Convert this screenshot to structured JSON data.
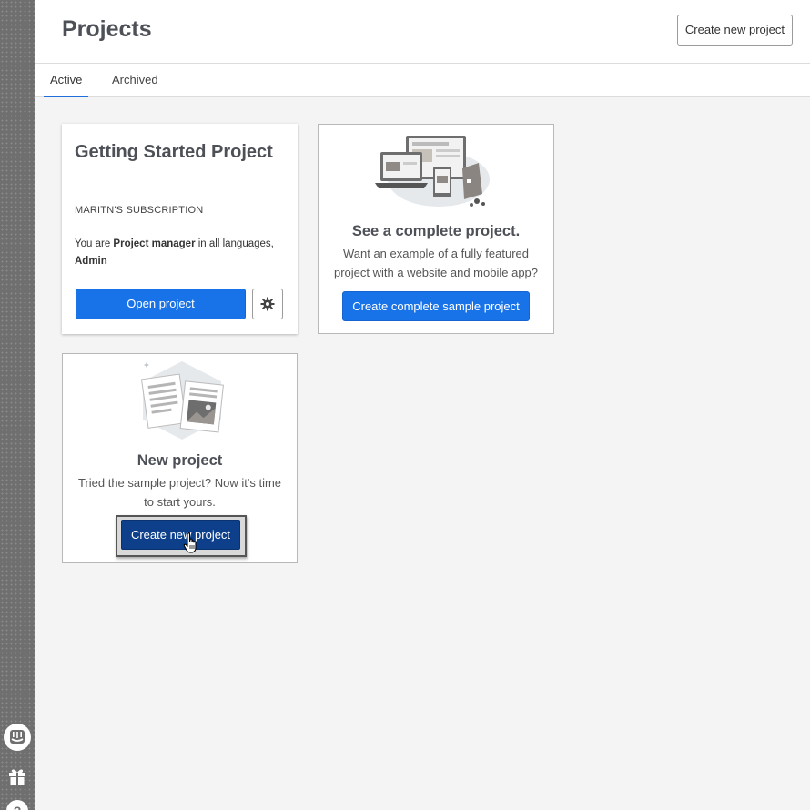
{
  "header": {
    "title": "Projects",
    "create_button": "Create new project"
  },
  "tabs": [
    {
      "label": "Active",
      "active": true
    },
    {
      "label": "Archived",
      "active": false
    }
  ],
  "project_card": {
    "title": "Getting Started Project",
    "subscription": "MARITN'S SUBSCRIPTION",
    "role_prefix": "You are ",
    "role": "Project manager",
    "role_mid": " in all languages,",
    "role_extra": "Admin",
    "open_button": "Open project",
    "settings_icon": "gear-icon"
  },
  "sample_card": {
    "title": "See a complete project.",
    "description_line1": "Want an example of a fully featured",
    "description_line2": "project with a website and mobile app?",
    "button": "Create complete sample project"
  },
  "new_card": {
    "title": "New project",
    "description_line1": "Tried the sample project? Now it's time",
    "description_line2": "to start yours.",
    "button": "Create new project"
  },
  "sidebar": {
    "icons": [
      "chat-icon",
      "gift-icon",
      "help-icon"
    ]
  },
  "colors": {
    "primary_blue": "#1973e8",
    "dark_blue": "#0d3f8a",
    "tab_underline": "#1e6fd9",
    "title_gray": "#4d5057"
  }
}
